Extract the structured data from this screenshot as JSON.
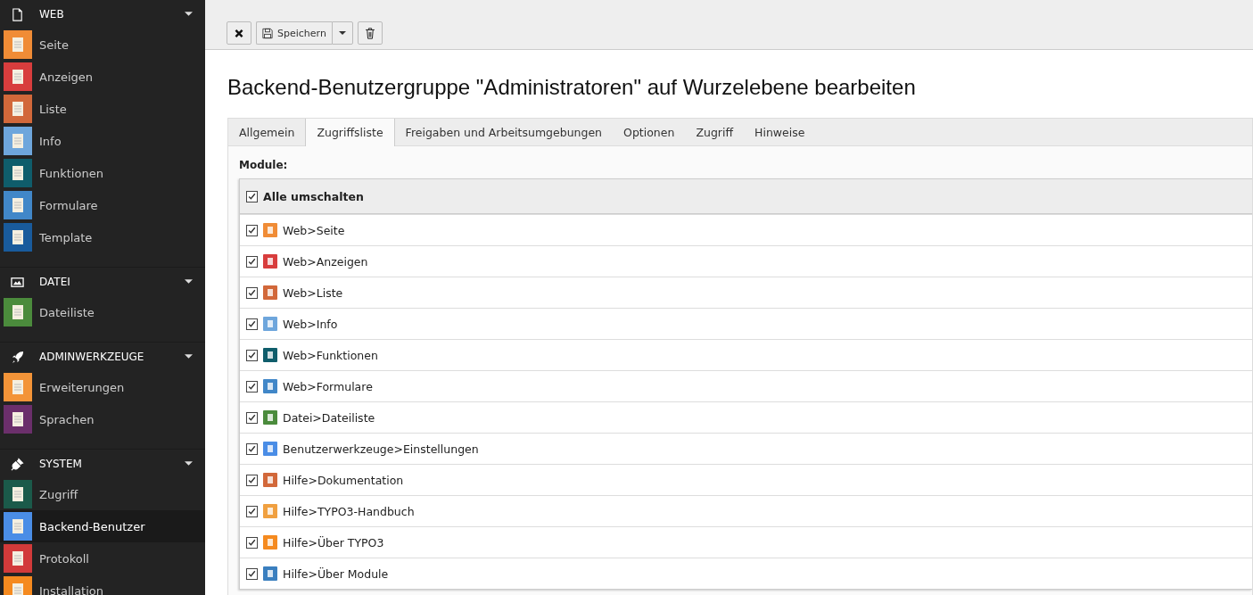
{
  "sidebar": {
    "groups": [
      {
        "kind": "page",
        "title": "WEB",
        "expanded": true,
        "items": [
          {
            "label": "Seite",
            "color": "#f08c36",
            "selected": false
          },
          {
            "label": "Anzeigen",
            "color": "#d83d3d",
            "selected": false
          },
          {
            "label": "Liste",
            "color": "#d2683a",
            "selected": false
          },
          {
            "label": "Info",
            "color": "#6ea6dc",
            "selected": false
          },
          {
            "label": "Funktionen",
            "color": "#0f5d6b",
            "selected": false
          },
          {
            "label": "Formulare",
            "color": "#4187c8",
            "selected": false
          },
          {
            "label": "Template",
            "color": "#195b9c",
            "selected": false
          }
        ]
      },
      {
        "kind": "image",
        "title": "DATEI",
        "expanded": true,
        "items": [
          {
            "label": "Dateiliste",
            "color": "#4b8b3c",
            "selected": false
          }
        ]
      },
      {
        "kind": "rocket",
        "title": "ADMINWERKZEUGE",
        "expanded": true,
        "items": [
          {
            "label": "Erweiterungen",
            "color": "#f39438",
            "selected": false
          },
          {
            "label": "Sprachen",
            "color": "#6b2f6b",
            "selected": false
          }
        ]
      },
      {
        "kind": "plug",
        "title": "SYSTEM",
        "expanded": true,
        "items": [
          {
            "label": "Zugriff",
            "color": "#1b5a4a",
            "selected": false
          },
          {
            "label": "Backend-Benutzer",
            "color": "#4a8de6",
            "selected": true
          },
          {
            "label": "Protokoll",
            "color": "#d23a3a",
            "selected": false
          },
          {
            "label": "Installation",
            "color": "#f58a1f",
            "selected": false
          }
        ]
      }
    ]
  },
  "toolbar": {
    "save_label": "Speichern"
  },
  "title": "Backend-Benutzergruppe \"Administratoren\" auf Wurzelebene bearbeiten",
  "tabs": [
    {
      "label": "Allgemein",
      "selected": false
    },
    {
      "label": "Zugriffsliste",
      "selected": true
    },
    {
      "label": "Freigaben und Arbeitsumgebungen",
      "selected": false
    },
    {
      "label": "Optionen",
      "selected": false
    },
    {
      "label": "Zugriff",
      "selected": false
    },
    {
      "label": "Hinweise",
      "selected": false
    }
  ],
  "modules": {
    "label": "Module:",
    "toggle_all": {
      "label": "Alle umschalten",
      "checked": true
    },
    "rows": [
      {
        "label": "Web>Seite",
        "color": "#f08c36",
        "checked": true
      },
      {
        "label": "Web>Anzeigen",
        "color": "#d83d3d",
        "checked": true
      },
      {
        "label": "Web>Liste",
        "color": "#d2683a",
        "checked": true
      },
      {
        "label": "Web>Info",
        "color": "#6ea6dc",
        "checked": true
      },
      {
        "label": "Web>Funktionen",
        "color": "#0f5d6b",
        "checked": true
      },
      {
        "label": "Web>Formulare",
        "color": "#4187c8",
        "checked": true
      },
      {
        "label": "Datei>Dateiliste",
        "color": "#4b8b3c",
        "checked": true
      },
      {
        "label": "Benutzerwerkzeuge>Einstellungen",
        "color": "#4a8de6",
        "checked": true
      },
      {
        "label": "Hilfe>Dokumentation",
        "color": "#d2683a",
        "checked": true
      },
      {
        "label": "Hilfe>TYPO3-Handbuch",
        "color": "#f0a040",
        "checked": true
      },
      {
        "label": "Hilfe>Über TYPO3",
        "color": "#f58a1f",
        "checked": true
      },
      {
        "label": "Hilfe>Über Module",
        "color": "#3a7fbf",
        "checked": true
      }
    ]
  }
}
